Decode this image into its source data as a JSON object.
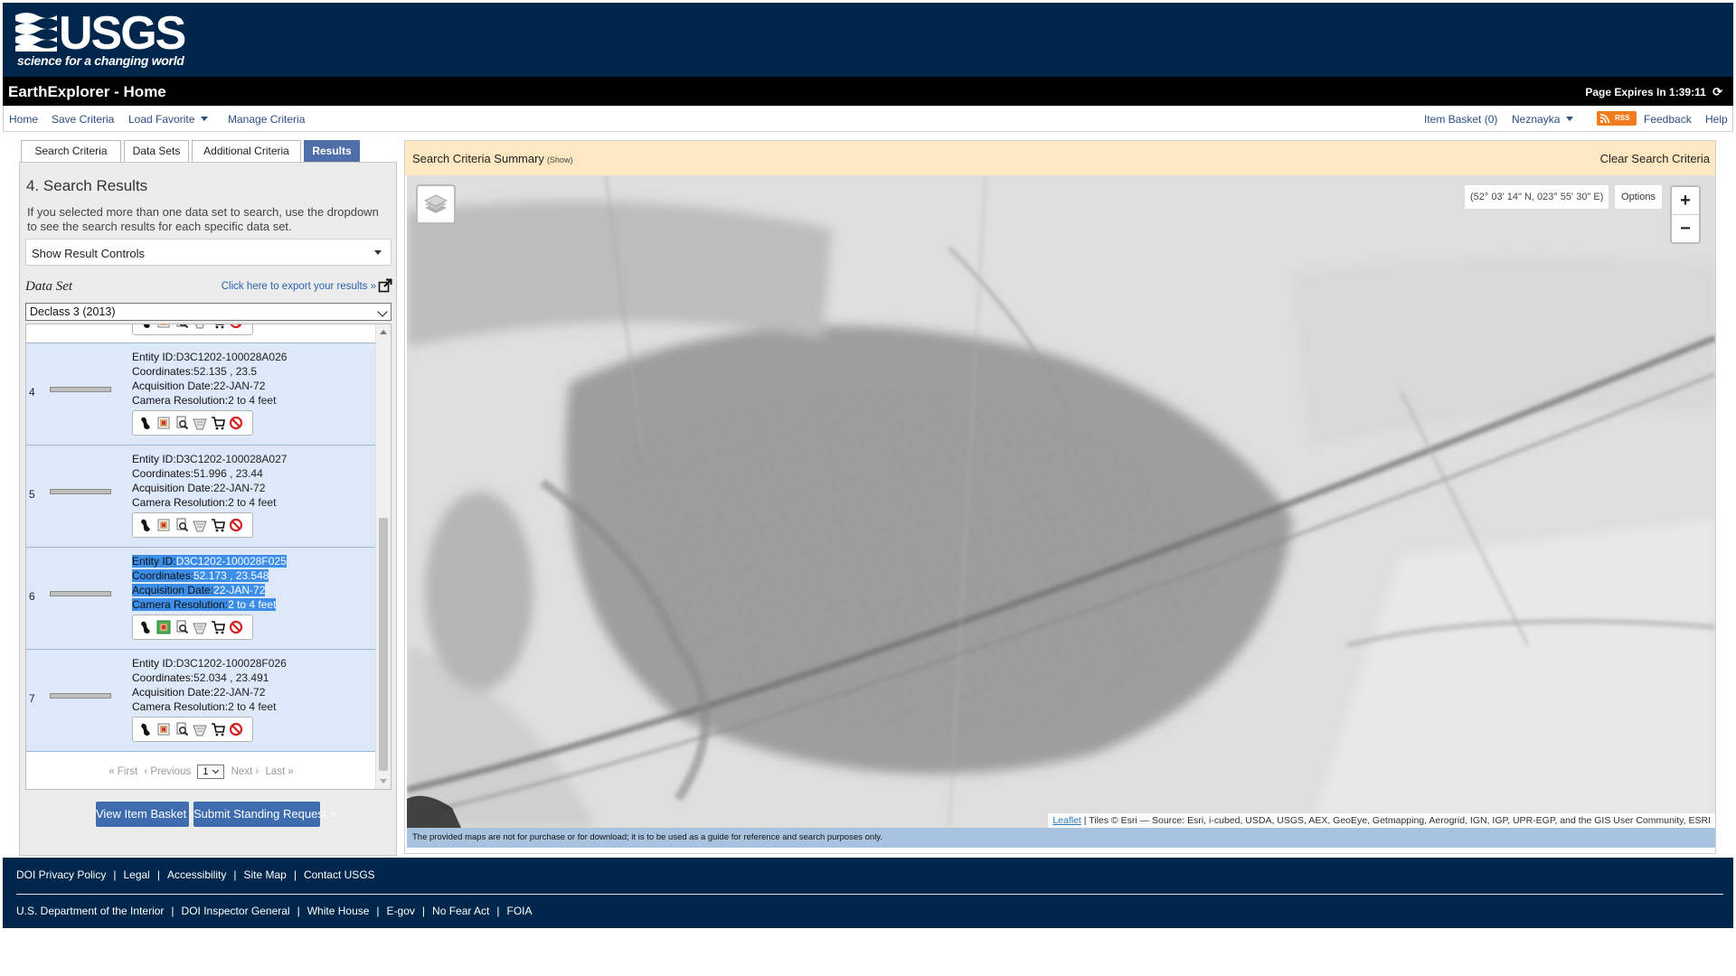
{
  "header": {
    "logo_word": "USGS",
    "logo_tagline": "science for a changing world",
    "app_title": "EarthExplorer - Home",
    "page_expires": "Page Expires In 1:39:11"
  },
  "nav": {
    "home": "Home",
    "save_criteria": "Save Criteria",
    "load_favorite": "Load Favorite",
    "manage_criteria": "Manage Criteria",
    "item_basket": "Item Basket (0)",
    "user": "Neznayka",
    "rss": "RSS",
    "feedback": "Feedback",
    "help": "Help"
  },
  "tabs": {
    "search_criteria": "Search Criteria",
    "data_sets": "Data Sets",
    "additional_criteria": "Additional Criteria",
    "results": "Results"
  },
  "results_panel": {
    "heading": "4. Search Results",
    "description": "If you selected more than one data set to search, use the dropdown to see the search results for each specific data set.",
    "show_result_controls": "Show Result Controls",
    "data_set_label": "Data Set",
    "export_link": "Click here to export your results »",
    "data_set_selected": "Declass 3 (2013)",
    "rows": [
      {
        "num": "4",
        "entity_label": "Entity ID:",
        "entity_id": "D3C1202-100028A026",
        "coords_label": "Coordinates:",
        "coords": "52.135 , 23.5",
        "acq_label": "Acquisition Date:",
        "acq_date": "22-JAN-72",
        "res_label": "Camera Resolution:",
        "resolution": "2 to 4 feet"
      },
      {
        "num": "5",
        "entity_label": "Entity ID:",
        "entity_id": "D3C1202-100028A027",
        "coords_label": "Coordinates:",
        "coords": "51.996 , 23.44",
        "acq_label": "Acquisition Date:",
        "acq_date": "22-JAN-72",
        "res_label": "Camera Resolution:",
        "resolution": "2 to 4 feet"
      },
      {
        "num": "6",
        "entity_label": "Entity ID:",
        "entity_id": "D3C1202-100028F025",
        "coords_label": "Coordinates:",
        "coords": "52.173 , 23.548",
        "acq_label": "Acquisition Date:",
        "acq_date": "22-JAN-72",
        "res_label": "Camera Resolution:",
        "resolution": "2 to 4 feet"
      },
      {
        "num": "7",
        "entity_label": "Entity ID:",
        "entity_id": "D3C1202-100028F026",
        "coords_label": "Coordinates:",
        "coords": "52.034 , 23.491",
        "acq_label": "Acquisition Date:",
        "acq_date": "22-JAN-72",
        "res_label": "Camera Resolution:",
        "resolution": "2 to 4 feet"
      }
    ],
    "selected_row": "6",
    "toolbar_icons": [
      "footprint-icon",
      "browse-overlay-icon",
      "show-metadata-icon",
      "compare-icon",
      "add-to-basket-icon",
      "exclude-icon"
    ],
    "pager": {
      "first": "« First",
      "previous": "‹ Previous",
      "page": "1",
      "next": "Next ›",
      "last": "Last »"
    },
    "view_basket": "View Item Basket »",
    "submit_request": "Submit Standing Request »"
  },
  "map_panel": {
    "criteria_title": "Search Criteria Summary",
    "criteria_show": "(Show)",
    "clear_criteria": "Clear Search Criteria",
    "coordinates": "(52° 03' 14\" N, 023° 55' 30\" E)",
    "options": "Options",
    "zoom_in": "+",
    "zoom_out": "−",
    "attribution_leaflet": "Leaflet",
    "attribution_text": " | Tiles © Esri — Source: Esri, i-cubed, USDA, USGS, AEX, GeoEye, Getmapping, Aerogrid, IGN, IGP, UPR-EGP, and the GIS User Community, ESRI",
    "disclaimer": "The provided maps are not for purchase or for download; it is to be used as a guide for reference and search purposes only."
  },
  "footer": {
    "row1": [
      "DOI Privacy Policy",
      "Legal",
      "Accessibility",
      "Site Map",
      "Contact USGS"
    ],
    "row2": [
      "U.S. Department of the Interior",
      "DOI Inspector General",
      "White House",
      "E-gov",
      "No Fear Act",
      "FOIA"
    ]
  },
  "colors": {
    "header_bg": "#00264c",
    "title_bar_bg": "#000000",
    "active_tab": "#4e6fa8",
    "criteria_bar": "#fde8c2",
    "selection": "#3d8ee8",
    "button_blue": "#3e6cae"
  }
}
